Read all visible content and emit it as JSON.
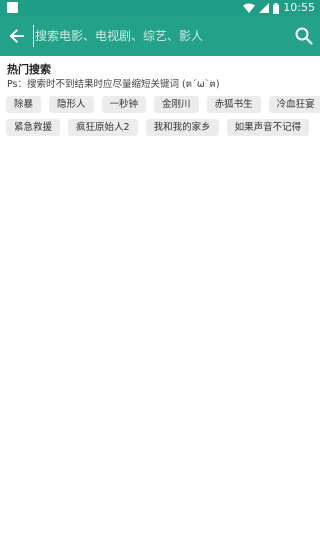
{
  "status_bar": {
    "time": "10:55"
  },
  "search": {
    "placeholder": "搜索电影、电视剧、综艺、影人"
  },
  "hot": {
    "title": "热门搜索",
    "hint": "Ps：搜索时不到结果时应尽量缩短关键词 (ฅ´ω`ฅ)",
    "rows": [
      [
        "除暴",
        "隐形人",
        "一秒钟",
        "金刚川",
        "赤狐书生",
        "冷血狂宴"
      ],
      [
        "紧急救援",
        "疯狂原始人2",
        "我和我的家乡",
        "如果声音不记得"
      ]
    ]
  },
  "colors": {
    "primary": "#23a189",
    "status_bar": "#1f9d86",
    "tag_bg": "#ececec"
  }
}
